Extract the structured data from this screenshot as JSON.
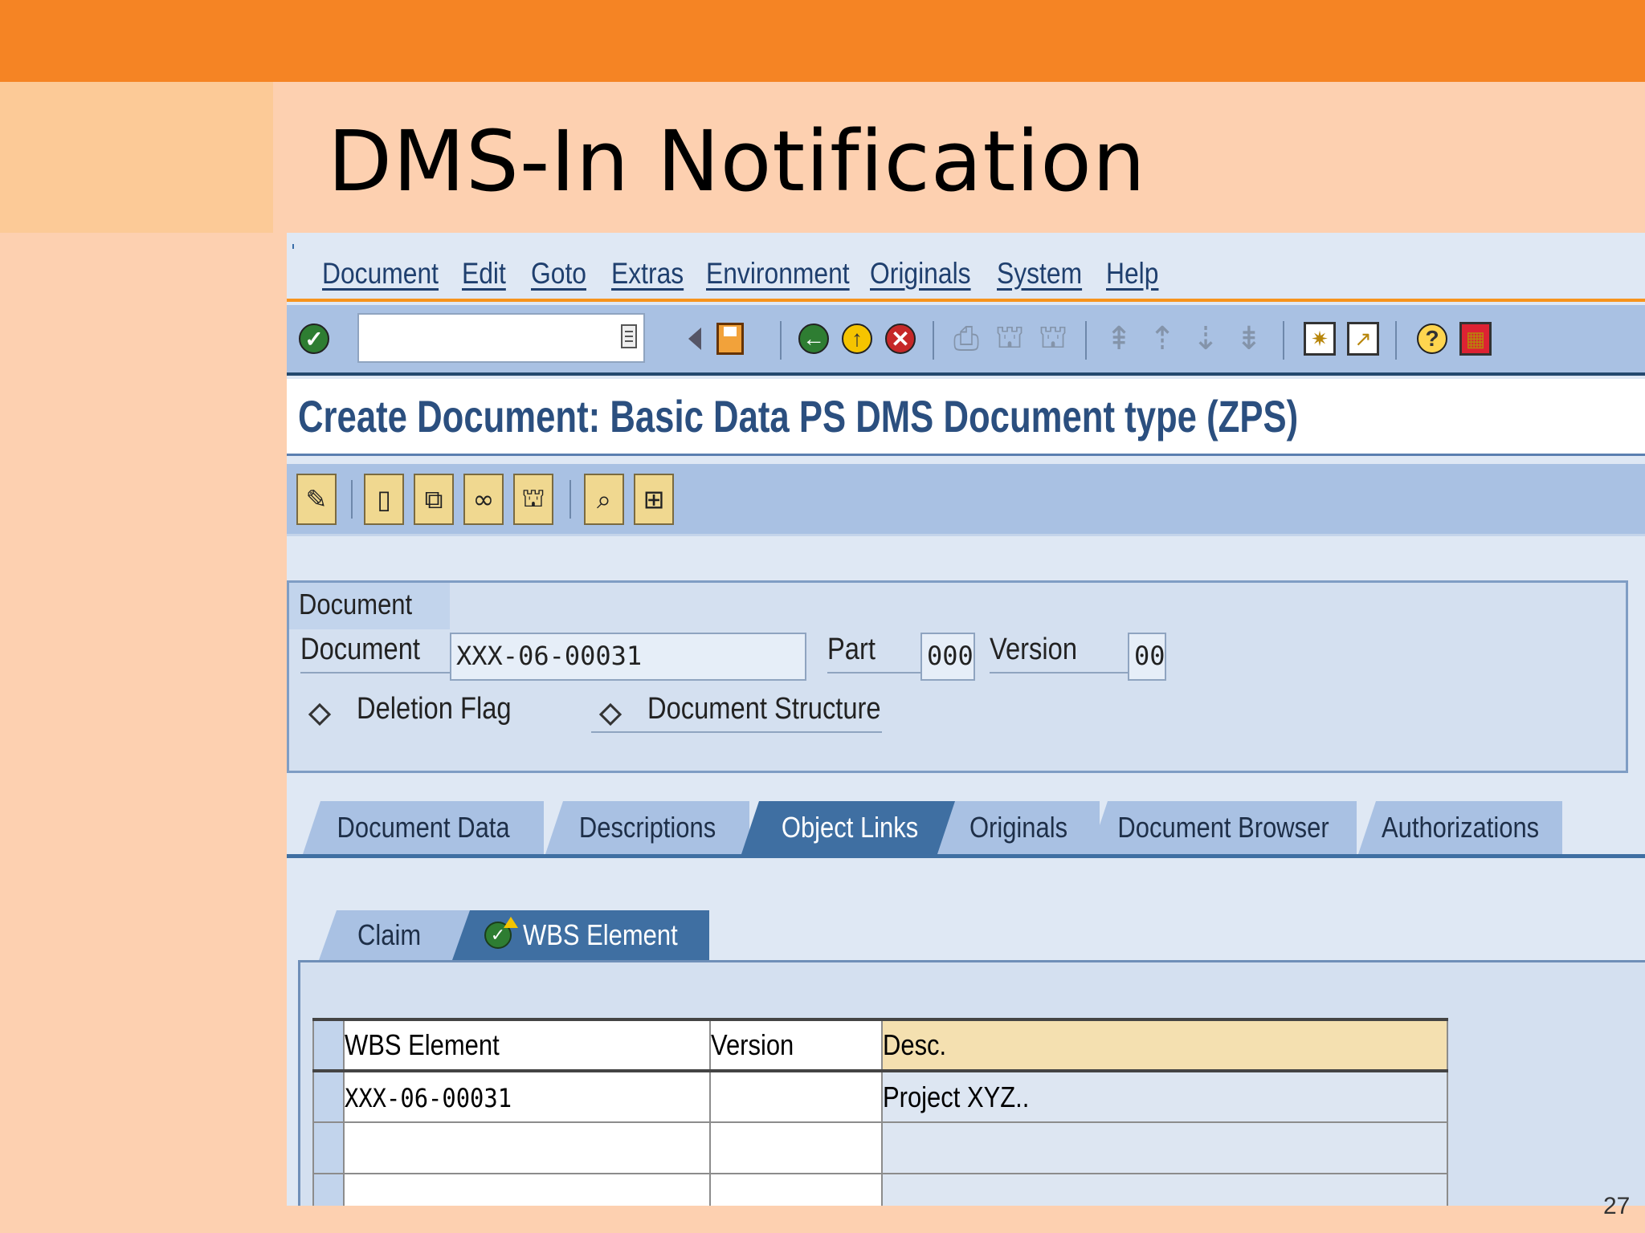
{
  "slide": {
    "title": "DMS-In Notification",
    "number": "27"
  },
  "menu": {
    "items": [
      "Document",
      "Edit",
      "Goto",
      "Extras",
      "Environment",
      "Originals",
      "System",
      "Help"
    ]
  },
  "system_toolbar": {
    "command_field_value": "",
    "icons": [
      "enter-icon",
      "back-triangle-icon",
      "save-icon",
      "back-icon",
      "exit-icon",
      "cancel-icon",
      "print-icon",
      "find-icon",
      "find-next-icon",
      "first-page-icon",
      "previous-page-icon",
      "next-page-icon",
      "last-page-icon",
      "create-session-icon",
      "shortcut-icon",
      "help-icon",
      "customize-layout-icon"
    ]
  },
  "screen": {
    "title": "Create Document: Basic Data PS DMS Document type (ZPS)"
  },
  "app_toolbar": {
    "icons": [
      "edit-pencil-icon",
      "new-document-icon",
      "copy-document-icon",
      "link-icon",
      "find-document-icon",
      "display-zoom-icon",
      "hierarchy-icon"
    ]
  },
  "document_group": {
    "title": "Document",
    "document_label": "Document",
    "document_value": "XXX-06-00031",
    "part_label": "Part",
    "part_value": "000",
    "version_label": "Version",
    "version_value": "00",
    "deletion_flag_label": "Deletion Flag",
    "document_structure_label": "Document Structure"
  },
  "tabs": {
    "items": [
      "Document Data",
      "Descriptions",
      "Object Links",
      "Originals",
      "Document Browser",
      "Authorizations"
    ],
    "active": "Object Links"
  },
  "subtabs": {
    "items": [
      "Claim",
      "WBS Element"
    ],
    "active": "WBS Element"
  },
  "object_links_table": {
    "columns": [
      "WBS Element",
      "Version",
      "Desc."
    ],
    "rows": [
      [
        "XXX-06-00031",
        "",
        "Project XYZ.."
      ],
      [
        "",
        "",
        ""
      ],
      [
        "",
        "",
        ""
      ]
    ]
  },
  "colors": {
    "slide_orange": "#f58424",
    "slide_peach": "#fdd0b0",
    "sap_toolbar_blue": "#a9c1e3",
    "sap_title_blue": "#2b4f7f",
    "active_tab_blue": "#3f6fa2",
    "table_header": "#f4e0b0"
  }
}
